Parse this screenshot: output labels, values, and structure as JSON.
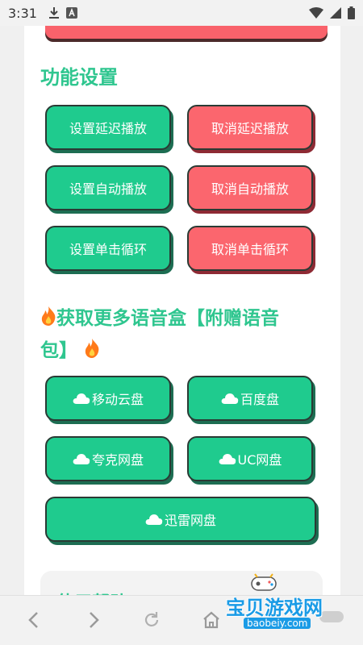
{
  "status_bar": {
    "time": "3:31"
  },
  "sections": {
    "settings_title": "功能设置",
    "more_title_line1": "获取更多语音盒【附赠语音",
    "more_title_line2": "包】",
    "help_title": "使用帮助"
  },
  "settings_buttons": [
    {
      "label": "设置延迟播放",
      "color": "#1fcb8e"
    },
    {
      "label": "取消延迟播放",
      "color": "#fb666e"
    },
    {
      "label": "设置自动播放",
      "color": "#1fcb8e"
    },
    {
      "label": "取消自动播放",
      "color": "#fb666e"
    },
    {
      "label": "设置单击循环",
      "color": "#1fcb8e"
    },
    {
      "label": "取消单击循环",
      "color": "#fb666e"
    }
  ],
  "download_buttons": [
    {
      "label": "移动云盘",
      "icon": "cloud-icon"
    },
    {
      "label": "百度盘",
      "icon": "cloud-icon"
    },
    {
      "label": "夸克网盘",
      "icon": "cloud-icon"
    },
    {
      "label": "UC网盘",
      "icon": "cloud-icon"
    },
    {
      "label": "迅雷网盘",
      "icon": "cloud-icon"
    }
  ],
  "watermark": {
    "title": "宝贝游戏网",
    "url": "baobeiy.com"
  },
  "colors": {
    "accent_green": "#1fcb8e",
    "accent_red": "#fb666e",
    "title_green": "#2fc68f"
  }
}
